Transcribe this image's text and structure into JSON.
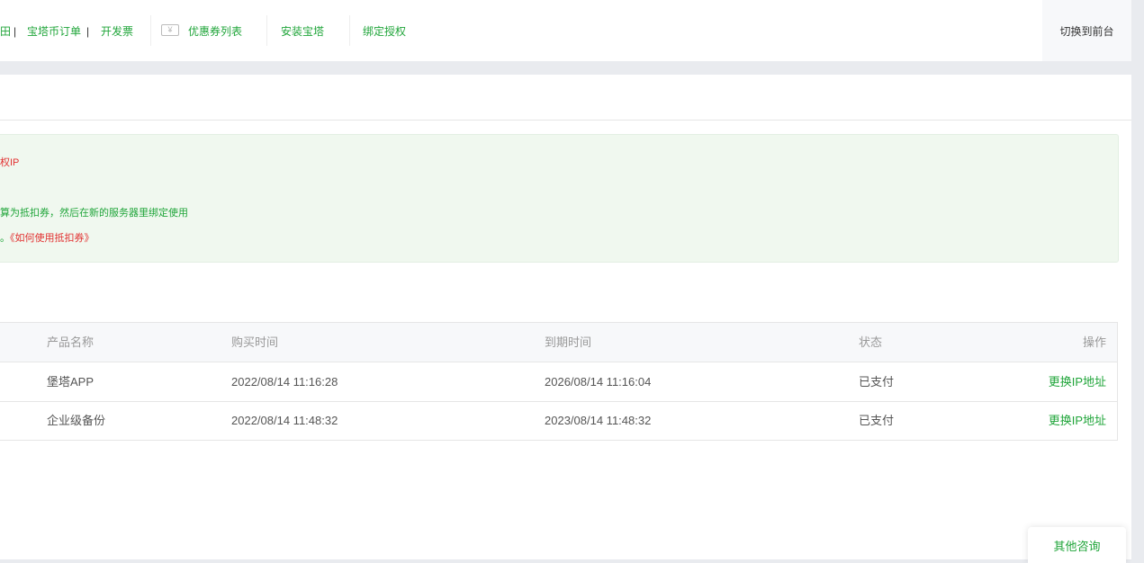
{
  "nav": {
    "items": [
      {
        "label": "田"
      },
      {
        "sep": "|"
      },
      {
        "label": "宝塔币订单"
      },
      {
        "sep": "|"
      },
      {
        "label": "开发票"
      },
      {
        "label": "优惠券列表"
      },
      {
        "label": "安装宝塔"
      },
      {
        "label": "绑定授权"
      }
    ],
    "coupon_icon_glyph": "¥",
    "switch_front": "切换到前台"
  },
  "notice": {
    "line1": "权IP",
    "line2": "算为抵扣券，然后在新的服务器里绑定使用",
    "line3_prefix": "。",
    "line3_link": "《如何使用抵扣券》"
  },
  "table": {
    "headers": [
      "产品名称",
      "购买时间",
      "到期时间",
      "状态",
      "操作"
    ],
    "rows": [
      [
        "堡塔APP",
        "2022/08/14 11:16:28",
        "2026/08/14 11:16:04",
        "已支付",
        "更换IP地址"
      ],
      [
        "企业级备份",
        "2022/08/14 11:48:32",
        "2023/08/14 11:48:32",
        "已支付",
        "更换IP地址"
      ]
    ]
  },
  "consult": "其他咨询",
  "colors": {
    "accent": "#20a53a",
    "warning": "#e23131"
  }
}
